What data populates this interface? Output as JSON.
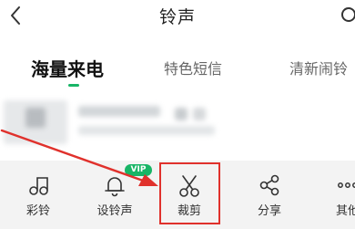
{
  "header": {
    "title": "铃声",
    "back_icon": "chevron-left-icon",
    "search_icon": "search-icon"
  },
  "tabs": [
    {
      "label": "海量来电",
      "active": true
    },
    {
      "label": "特色短信",
      "active": false
    },
    {
      "label": "清新闹铃",
      "active": false
    }
  ],
  "toolbar": {
    "items": [
      {
        "label": "彩铃",
        "icon": "music-note-icon"
      },
      {
        "label": "设铃声",
        "icon": "bell-icon",
        "badge": "VIP"
      },
      {
        "label": "裁剪",
        "icon": "scissors-icon"
      },
      {
        "label": "分享",
        "icon": "share-icon"
      },
      {
        "label": "其他",
        "icon": "more-icon"
      }
    ]
  },
  "colors": {
    "accent": "#18b566",
    "annotation": "#e0312c",
    "toolbar_bg": "#f3f3f3"
  }
}
